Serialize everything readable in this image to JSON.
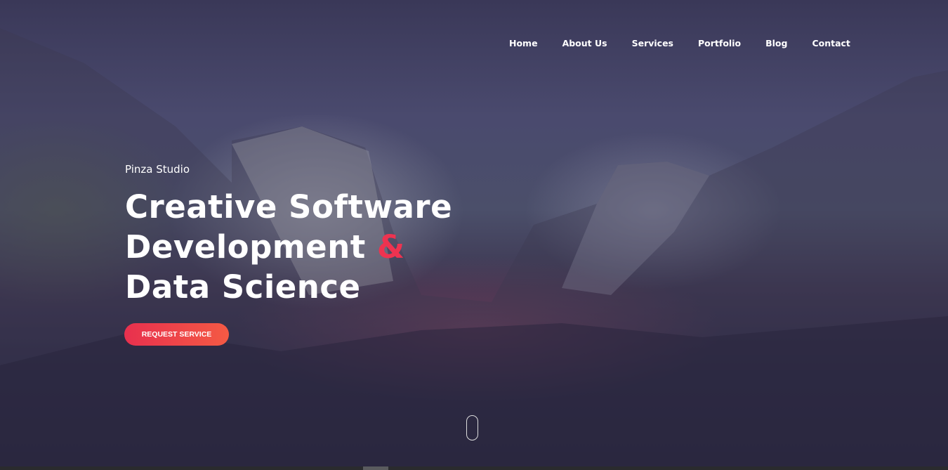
{
  "nav": {
    "items": [
      {
        "label": "Home"
      },
      {
        "label": "About Us"
      },
      {
        "label": "Services"
      },
      {
        "label": "Portfolio"
      },
      {
        "label": "Blog"
      },
      {
        "label": "Contact"
      }
    ]
  },
  "hero": {
    "tagline": "Pinza Studio",
    "title_part1": "Creative Software Development ",
    "title_amp": "&",
    "title_part2": " Data Science",
    "cta_label": "REQUEST SERVICE"
  },
  "colors": {
    "accent": "#ee3350",
    "button_gradient_start": "#e8304e",
    "button_gradient_end": "#f45a44"
  },
  "icons": {
    "scroll_indicator": "mouse-scroll-icon"
  }
}
